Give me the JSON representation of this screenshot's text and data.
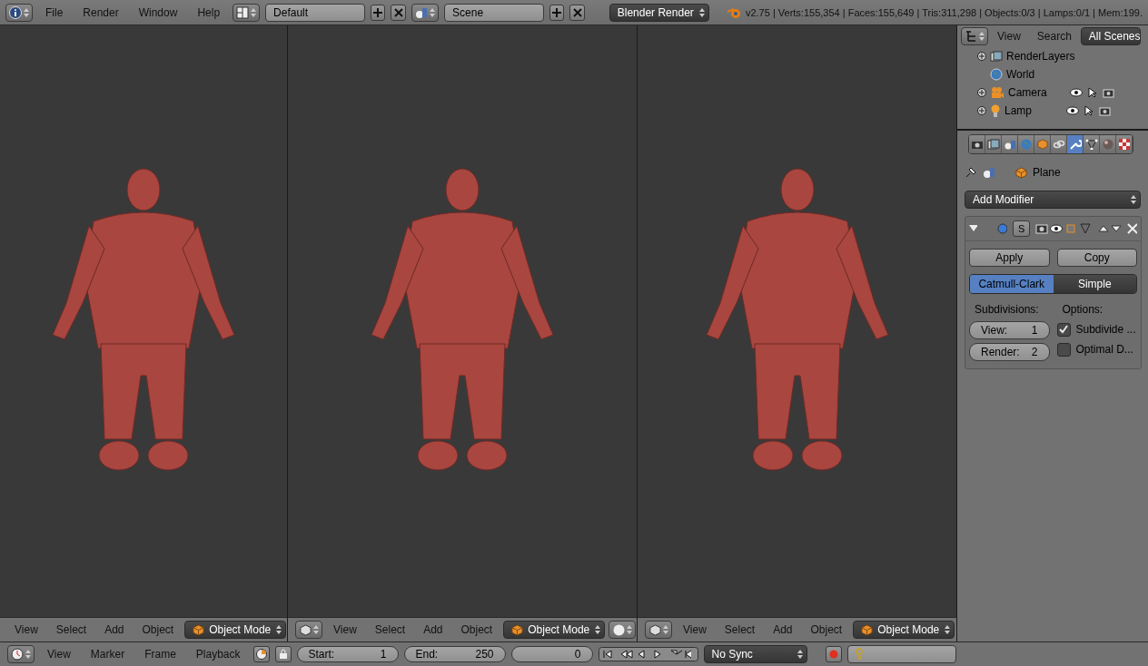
{
  "top_bar": {
    "menus": [
      "File",
      "Render",
      "Window",
      "Help"
    ],
    "layout": "Default",
    "scene": "Scene",
    "engine": "Blender Render",
    "stats": "v2.75 | Verts:155,354 | Faces:155,649 | Tris:311,298 | Objects:0/3 | Lamps:0/1 | Mem:199."
  },
  "viewports": [
    {
      "editor_icon": false,
      "menus": [
        "View",
        "Select",
        "Add",
        "Object"
      ],
      "mode": "Object Mode",
      "shading_button": false
    },
    {
      "editor_icon": true,
      "menus": [
        "View",
        "Select",
        "Add",
        "Object"
      ],
      "mode": "Object Mode",
      "shading_button": true
    },
    {
      "editor_icon": true,
      "menus": [
        "View",
        "Select",
        "Add",
        "Object"
      ],
      "mode": "Object Mode",
      "shading_button": false
    }
  ],
  "outliner": {
    "menus": [
      "View",
      "Search"
    ],
    "filter": "All Scenes",
    "items": [
      {
        "label": "RenderLayers",
        "kind": "renderlayers",
        "expandable": true,
        "restrict": false
      },
      {
        "label": "World",
        "kind": "world",
        "expandable": false,
        "restrict": false
      },
      {
        "label": "Camera",
        "kind": "camera",
        "expandable": true,
        "restrict": true
      },
      {
        "label": "Lamp",
        "kind": "lamp",
        "expandable": true,
        "restrict": true
      }
    ]
  },
  "properties": {
    "tabs": [
      {
        "kind": "render",
        "selected": false
      },
      {
        "kind": "layers",
        "selected": false
      },
      {
        "kind": "scene",
        "selected": false
      },
      {
        "kind": "world",
        "selected": false
      },
      {
        "kind": "object",
        "selected": false
      },
      {
        "kind": "constraints",
        "selected": false
      },
      {
        "kind": "modifiers",
        "selected": true
      },
      {
        "kind": "data",
        "selected": false
      },
      {
        "kind": "material",
        "selected": false
      },
      {
        "kind": "texture",
        "selected": false
      }
    ],
    "breadcrumb": "Plane",
    "add_modifier": "Add Modifier",
    "modifier": {
      "expanded": true,
      "name_initial": "S",
      "buttons": [
        "Apply",
        "Copy"
      ],
      "types": [
        {
          "label": "Catmull-Clark",
          "selected": true
        },
        {
          "label": "Simple",
          "selected": false
        }
      ],
      "subdivisions_label": "Subdivisions:",
      "fields": [
        {
          "label": "View:",
          "value": "1"
        },
        {
          "label": "Render:",
          "value": "2"
        }
      ],
      "options_label": "Options:",
      "options": [
        {
          "label": "Subdivide ...",
          "checked": true
        },
        {
          "label": "Optimal D...",
          "checked": false
        }
      ]
    }
  },
  "timeline": {
    "menus": [
      "View",
      "Marker",
      "Frame",
      "Playback"
    ],
    "start_label": "Start:",
    "start": "1",
    "end_label": "End:",
    "end": "250",
    "current": "0",
    "sync": "No Sync"
  }
}
